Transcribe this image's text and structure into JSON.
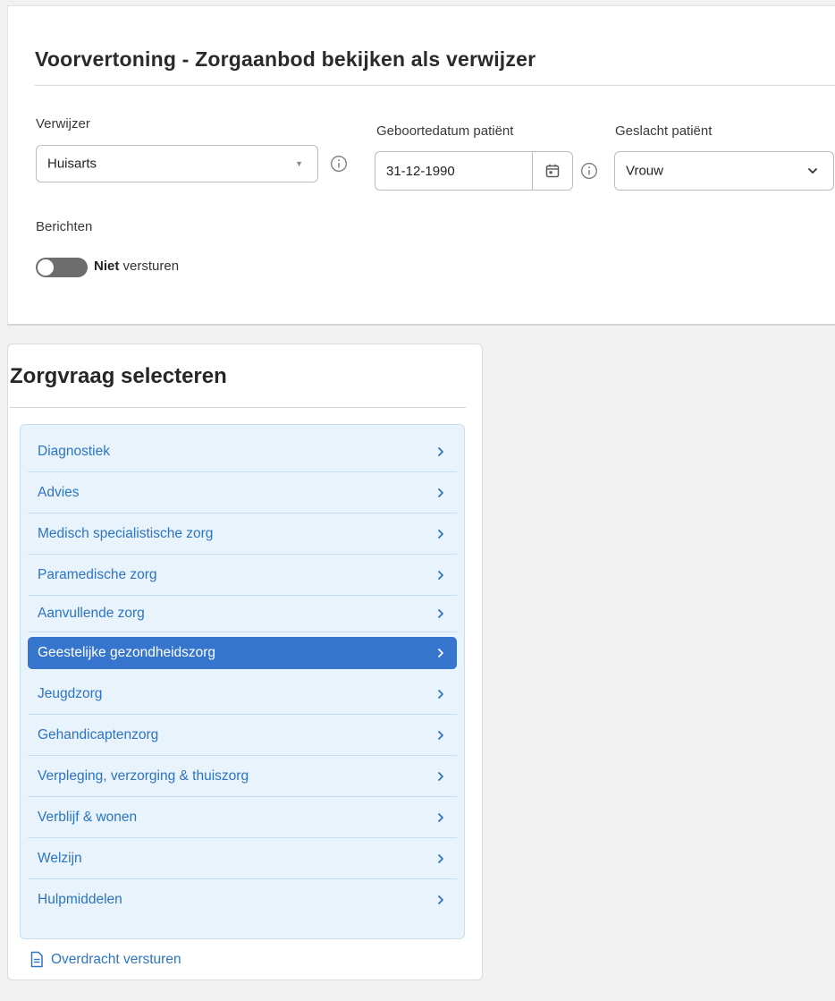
{
  "header": {
    "title": "Voorvertoning - Zorgaanbod bekijken als verwijzer"
  },
  "form": {
    "verwijzer": {
      "label": "Verwijzer",
      "value": "Huisarts"
    },
    "geboortedatum": {
      "label": "Geboortedatum patiënt",
      "value": "31-12-1990"
    },
    "geslacht": {
      "label": "Geslacht patiënt",
      "value": "Vrouw"
    },
    "berichten": {
      "label": "Berichten",
      "toggle_state": "off",
      "status_bold": "Niet",
      "status_text": "versturen"
    }
  },
  "zorgvraag": {
    "title": "Zorgvraag selecteren",
    "selected_index": 5,
    "categories": [
      {
        "label": "Diagnostiek"
      },
      {
        "label": "Advies"
      },
      {
        "label": "Medisch specialistische zorg"
      },
      {
        "label": "Paramedische zorg"
      },
      {
        "label": "Aanvullende zorg"
      },
      {
        "label": "Geestelijke gezondheidszorg"
      },
      {
        "label": "Jeugdzorg"
      },
      {
        "label": "Gehandicaptenzorg"
      },
      {
        "label": "Verpleging, verzorging & thuiszorg"
      },
      {
        "label": "Verblijf & wonen"
      },
      {
        "label": "Welzijn"
      },
      {
        "label": "Hulpmiddelen"
      }
    ],
    "overdracht_label": "Overdracht versturen"
  },
  "colors": {
    "link": "#2d74c4",
    "selected_bg": "#3575cd",
    "list_bg": "#e8f3fb",
    "toggle_off": "#6d6d6d"
  },
  "icons": {
    "info": "info-circle-icon",
    "calendar": "calendar-icon",
    "chevron_down": "chevron-down-icon",
    "chevron_right": "chevron-right-icon",
    "document": "document-icon"
  }
}
